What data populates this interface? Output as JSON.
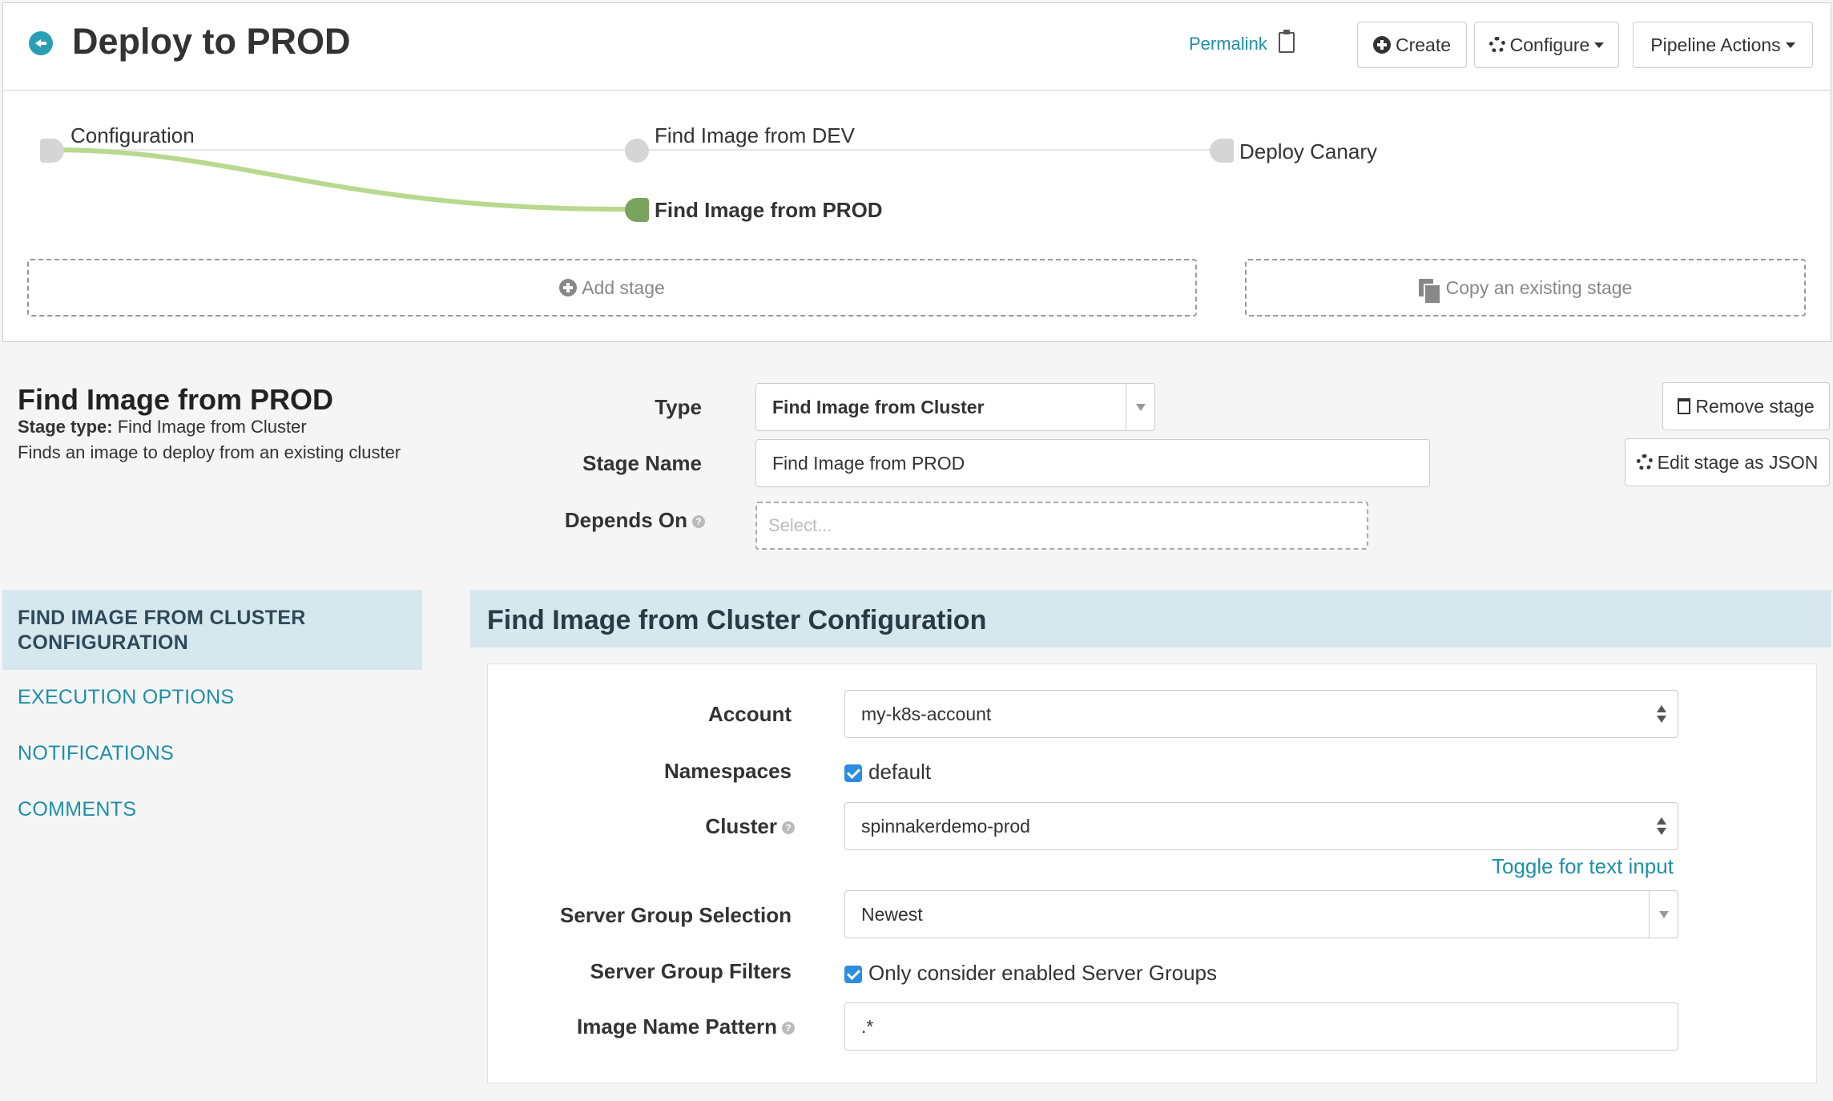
{
  "header": {
    "title": "Deploy to PROD",
    "permalink": "Permalink",
    "create_label": "Create",
    "configure_label": "Configure",
    "pipeline_actions_label": "Pipeline Actions"
  },
  "graph": {
    "nodes": [
      {
        "label": "Configuration",
        "active": false
      },
      {
        "label": "Find Image from DEV",
        "active": false
      },
      {
        "label": "Find Image from PROD",
        "active": true
      },
      {
        "label": "Deploy Canary",
        "active": false
      }
    ],
    "add_stage": "Add stage",
    "copy_stage": "Copy an existing stage",
    "colors": {
      "active_edge": "#b8d98e",
      "active_node": "#7aa35e",
      "inactive_node": "#d5d5d5"
    }
  },
  "stage": {
    "heading": "Find Image from PROD",
    "type_label": "Stage type:",
    "type_value": "Find Image from Cluster",
    "description": "Finds an image to deploy from an existing cluster",
    "type_field_label": "Type",
    "type_field_value": "Find Image from Cluster",
    "name_field_label": "Stage Name",
    "name_field_value": "Find Image from PROD",
    "depends_on_label": "Depends On",
    "depends_on_placeholder": "Select...",
    "remove_label": "Remove stage",
    "edit_json_label": "Edit stage as JSON"
  },
  "nav": {
    "items": [
      {
        "label": "FIND IMAGE FROM CLUSTER CONFIGURATION",
        "active": true
      },
      {
        "label": "EXECUTION OPTIONS",
        "active": false
      },
      {
        "label": "NOTIFICATIONS",
        "active": false
      },
      {
        "label": "COMMENTS",
        "active": false
      }
    ]
  },
  "config": {
    "title": "Find Image from Cluster Configuration",
    "account_label": "Account",
    "account_value": "my-k8s-account",
    "namespaces_label": "Namespaces",
    "namespaces_value": "default",
    "cluster_label": "Cluster",
    "cluster_value": "spinnakerdemo-prod",
    "toggle_text": "Toggle for text input",
    "server_group_selection_label": "Server Group Selection",
    "server_group_selection_value": "Newest",
    "server_group_filters_label": "Server Group Filters",
    "server_group_filters_value": "Only consider enabled Server Groups",
    "image_name_pattern_label": "Image Name Pattern",
    "image_name_pattern_value": ".*"
  },
  "colors": {
    "accent": "#1f8fa8",
    "nav_active_bg": "#d7e7ee",
    "checkbox": "#2b8ee0"
  }
}
